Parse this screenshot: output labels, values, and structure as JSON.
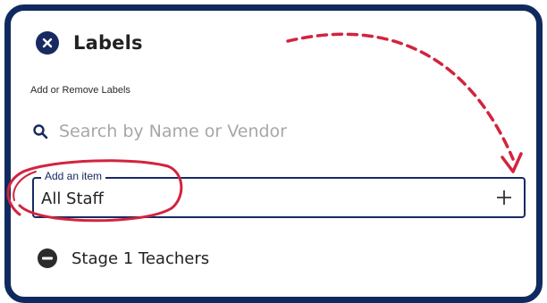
{
  "panel": {
    "title": "Labels",
    "subtitle": "Add or Remove Labels",
    "close_icon": "close-icon"
  },
  "search": {
    "placeholder": "Search by Name or Vendor",
    "icon": "search-icon"
  },
  "add_field": {
    "legend": "Add an item",
    "value": "All Staff",
    "action_icon": "plus-icon"
  },
  "labels": [
    {
      "label": "Stage 1 Teachers",
      "icon": "remove-icon"
    }
  ],
  "annotations": {
    "highlight_color": "#d2243f",
    "arrow_color": "#d2243f"
  },
  "colors": {
    "frame": "#0f2a5e",
    "accent": "#172a61",
    "placeholder": "#a7a7a7"
  }
}
